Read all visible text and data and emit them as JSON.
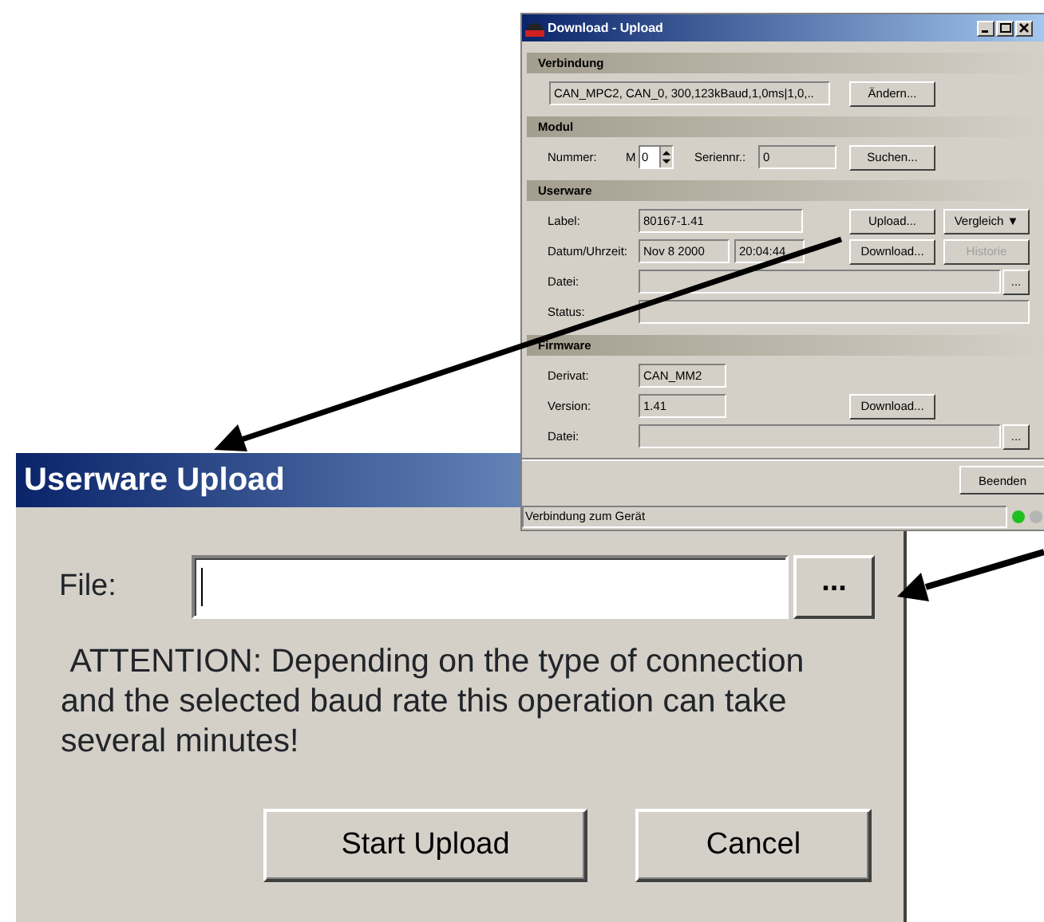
{
  "main_window": {
    "title": "Download - Upload",
    "sections": [
      {
        "title": "Verbindung",
        "rows": [
          {
            "items": [
              {
                "kind": "field",
                "value": "CAN_MPC2, CAN_0, 300,123kBaud,1,0ms|1,0,.."
              },
              {
                "kind": "button",
                "label": "Ändern...",
                "disabled": false
              }
            ]
          }
        ]
      },
      {
        "title": "Modul",
        "rows": [
          {
            "label": "Nummer:",
            "items": [
              {
                "kind": "text",
                "text": "M"
              },
              {
                "kind": "spinner",
                "value": "0"
              },
              {
                "kind": "text",
                "text": "Seriennr.:"
              },
              {
                "kind": "field",
                "value": "0"
              },
              {
                "kind": "button",
                "label": "Suchen...",
                "disabled": false
              }
            ]
          }
        ]
      },
      {
        "title": "Userware",
        "rows": [
          {
            "label": "Label:",
            "items": [
              {
                "kind": "field",
                "value": "80167-1.41"
              },
              {
                "kind": "button",
                "label": "Upload...",
                "disabled": false
              },
              {
                "kind": "dropdown",
                "label": "Vergleich",
                "caret": "▼"
              }
            ]
          },
          {
            "label": "Datum/Uhrzeit:",
            "items": [
              {
                "kind": "field",
                "value": "Nov  8 2000"
              },
              {
                "kind": "field",
                "value": "20:04:44"
              },
              {
                "kind": "button",
                "label": "Download...",
                "disabled": false
              },
              {
                "kind": "button",
                "label": "Historie",
                "disabled": true
              }
            ]
          },
          {
            "label": "Datei:",
            "items": [
              {
                "kind": "field"
              },
              {
                "kind": "button",
                "label": "...",
                "disabled": false
              }
            ]
          },
          {
            "label": "Status:",
            "items": [
              {
                "kind": "field"
              }
            ]
          }
        ]
      },
      {
        "title": "Firmware",
        "rows": [
          {
            "label": "Derivat:",
            "items": [
              {
                "kind": "field",
                "value": "CAN_MM2"
              }
            ]
          },
          {
            "label": "Version:",
            "items": [
              {
                "kind": "field",
                "value": "1.41"
              },
              {
                "kind": "button",
                "label": "Download...",
                "disabled": false
              }
            ]
          },
          {
            "label": "Datei:",
            "items": [
              {
                "kind": "field"
              },
              {
                "kind": "button",
                "label": "...",
                "disabled": false
              }
            ]
          }
        ]
      }
    ],
    "close_button": "Beenden",
    "status_bar": {
      "text": "Verbindung zum Gerät",
      "lights": [
        {
          "color": "#1fbf1f"
        },
        {
          "color": "#b4b4b4"
        }
      ]
    }
  },
  "upload_dialog": {
    "title": "Userware Upload",
    "file_label": "File:",
    "browse_button": "...",
    "message": " ATTENTION: Depending on the type of connection and the selected baud rate this operation can take several minutes!",
    "buttons": [
      "Start Upload",
      "Cancel"
    ]
  }
}
